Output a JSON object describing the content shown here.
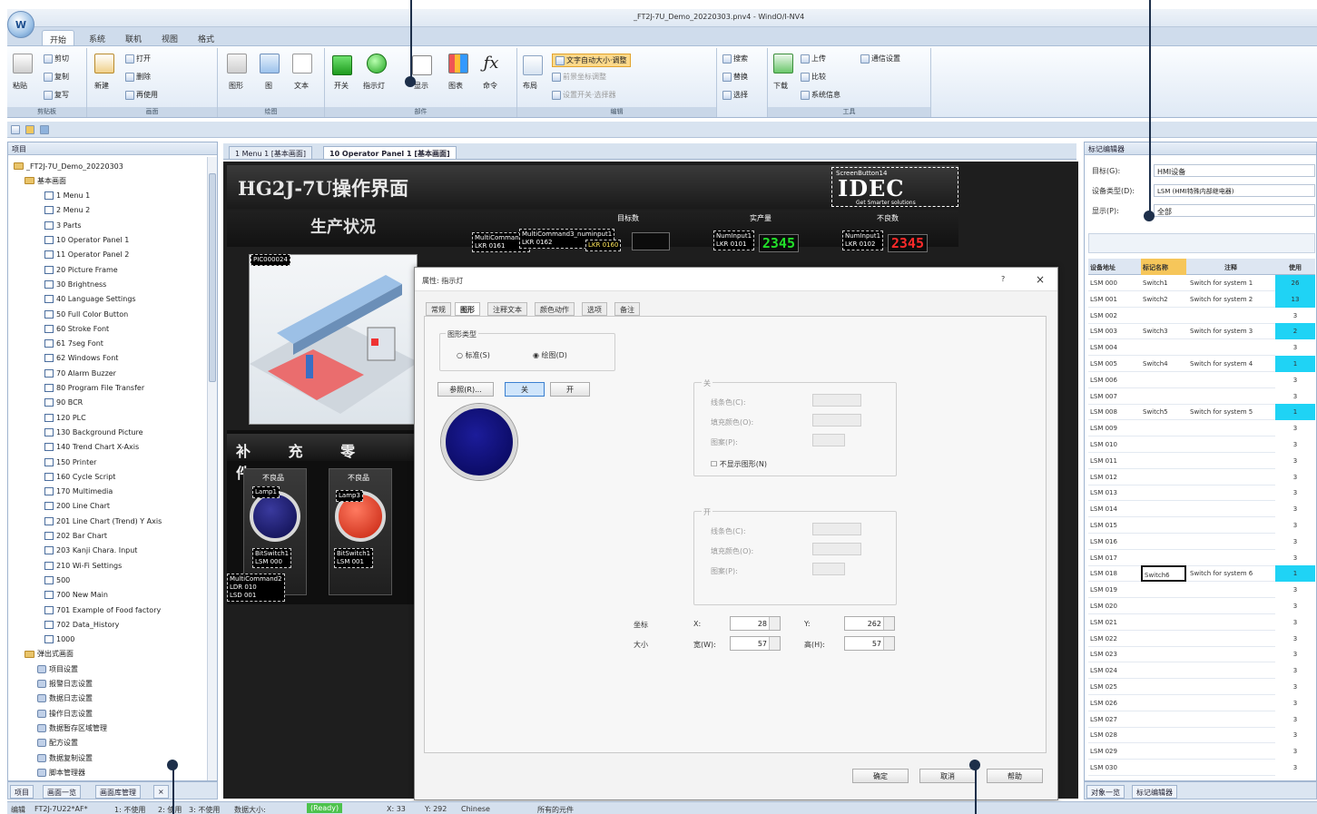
{
  "window": {
    "title": "_FT2J-7U_Demo_20220303.pnv4 - WindO/I-NV4",
    "app_logo": "W"
  },
  "ribbon": {
    "tabs": [
      "开始",
      "系统",
      "联机",
      "视图",
      "格式"
    ],
    "groups": [
      "剪贴板",
      "画面",
      "绘图",
      "部件",
      "编辑",
      "工具"
    ],
    "clipboard": {
      "paste": "粘贴",
      "cut": "剪切",
      "copy": "复制",
      "format_copy": "复写"
    },
    "screen": {
      "new": "新建",
      "open": "打开",
      "delete": "删除",
      "reuse": "再使用"
    },
    "drawing": {
      "shape": "图形",
      "image": "图",
      "text": "文本"
    },
    "parts": {
      "switch": "开关",
      "lamp": "指示灯",
      "display": "显示",
      "chart": "图表",
      "command": "命令"
    },
    "edit": {
      "layout": "布局",
      "auto_resize": "文字自动大小·调整",
      "f1": "前景坐标调整",
      "f2": "设置开关·选择器"
    },
    "find": {
      "search": "搜索",
      "replace": "替换",
      "select": "选择"
    },
    "tools": {
      "download": "下载",
      "upload": "上传",
      "compare": "比较",
      "sysinfo": "系统信息",
      "comm": "通信设置"
    }
  },
  "left_panel": {
    "title": "项目",
    "root": "_FT2J-7U_Demo_20220303",
    "base_folder": "基本画面",
    "screens": [
      "1 Menu 1",
      "2 Menu 2",
      "3 Parts",
      "10 Operator Panel 1",
      "11 Operator Panel 2",
      "20 Picture Frame",
      "30 Brightness",
      "40 Language Settings",
      "50 Full Color Button",
      "60 Stroke Font",
      "61 7seg Font",
      "62 Windows Font",
      "70 Alarm Buzzer",
      "80 Program File Transfer",
      "90 BCR",
      "120 PLC",
      "130 Background Picture",
      "140 Trend Chart X-Axis",
      "150 Printer",
      "160 Cycle Script",
      "170 Multimedia",
      "200 Line Chart",
      "201 Line Chart (Trend) Y Axis",
      "202 Bar Chart",
      "203 Kanji Chara. Input",
      "210 Wi-Fi Settings",
      "500",
      "700 New Main",
      "701 Example of Food factory",
      "702 Data_History",
      "1000"
    ],
    "other_items": [
      "弹出式画面",
      "项目设置",
      "报警日志设置",
      "数据日志设置",
      "操作日志设置",
      "数据暂存区域管理",
      "配方设置",
      "数据复制设置",
      "脚本管理器"
    ],
    "bottom_tabs": [
      "项目",
      "画面一览",
      "画面库管理",
      "×"
    ]
  },
  "doc_tabs": [
    "1 Menu 1 [基本画面]",
    "10 Operator Panel 1 [基本画面]"
  ],
  "hmi": {
    "title": "HG2J-7U操作界面",
    "idec_caption": "ScreenButton14",
    "idec_logo": "IDEC",
    "idec_sub": "Get Smarter solutions",
    "prod_title": "生产状况",
    "headers": [
      "目标数",
      "实产量",
      "不良数"
    ],
    "num1": {
      "name": "NumInput1",
      "addr": "LKR 0101",
      "value": "2345"
    },
    "num2": {
      "name": "NumInput1",
      "addr": "LKR 0102",
      "value": "2345"
    },
    "mc_tags": [
      "MultiCommand1",
      "LKR 0161",
      "MultiCommand3_numinput1",
      "LKR 0162",
      "LKR 0160"
    ],
    "factory_tag": "PIC000024",
    "lower_title": "补 充 零 件",
    "lamp1": {
      "caption": "不良品",
      "name": "Lamp1",
      "switch": "BitSwitch1",
      "addr": "LSM 000"
    },
    "lamp2": {
      "caption": "不良品",
      "name": "Lamp3",
      "switch": "BitSwitch1",
      "addr": "LSM 001"
    },
    "lower_tags": [
      "MultiCommand2",
      "LDR 010",
      "LSD 001"
    ]
  },
  "dialog": {
    "title": "属性: 指示灯",
    "help": "?",
    "close": "×",
    "tabs": [
      "常规",
      "图形",
      "注释文本",
      "颜色动作",
      "选项",
      "备注"
    ],
    "shape_type_label": "图形类型",
    "radio_std": "标准(S)",
    "radio_draw": "绘图(D)",
    "ref_button": "参照(R)...",
    "off_button": "关",
    "on_button": "开",
    "group_off": "关",
    "group_on": "开",
    "border_color": "线条色(C):",
    "fill_color": "填充颜色(O):",
    "pattern": "图案(P):",
    "no_display": "不显示图形(N)",
    "coord_label": "坐标",
    "size_label": "大小",
    "x_label": "X:",
    "y_label": "Y:",
    "w_label": "宽(W):",
    "h_label": "高(H):",
    "x_value": "28",
    "y_value": "262",
    "w_value": "57",
    "h_value": "57",
    "ok": "确定",
    "cancel": "取消",
    "help_btn": "帮助"
  },
  "right_panel": {
    "title": "标记编辑器",
    "target_label": "目标(G):",
    "target_value": "HMI设备",
    "type_label": "设备类型(D):",
    "type_value": "LSM (HMI特殊内部继电器)",
    "display_label": "显示(P):",
    "display_value": "全部",
    "columns": [
      "设备地址",
      "标记名称",
      "注释",
      "使用"
    ],
    "rows": [
      {
        "addr": "LSM 000",
        "tag": "Switch1",
        "comment": "Switch for system 1",
        "use": "26",
        "on": true
      },
      {
        "addr": "LSM 001",
        "tag": "Switch2",
        "comment": "Switch for system 2",
        "use": "13",
        "on": true
      },
      {
        "addr": "LSM 002",
        "tag": "",
        "comment": "",
        "use": "3",
        "on": false
      },
      {
        "addr": "LSM 003",
        "tag": "Switch3",
        "comment": "Switch for system 3",
        "use": "2",
        "on": true
      },
      {
        "addr": "LSM 004",
        "tag": "",
        "comment": "",
        "use": "3",
        "on": false
      },
      {
        "addr": "LSM 005",
        "tag": "Switch4",
        "comment": "Switch for system 4",
        "use": "1",
        "on": true
      },
      {
        "addr": "LSM 006",
        "tag": "",
        "comment": "",
        "use": "3",
        "on": false
      },
      {
        "addr": "LSM 007",
        "tag": "",
        "comment": "",
        "use": "3",
        "on": false
      },
      {
        "addr": "LSM 008",
        "tag": "Switch5",
        "comment": "Switch for system 5",
        "use": "1",
        "on": true
      },
      {
        "addr": "LSM 009",
        "tag": "",
        "comment": "",
        "use": "3",
        "on": false
      },
      {
        "addr": "LSM 010",
        "tag": "",
        "comment": "",
        "use": "3",
        "on": false
      },
      {
        "addr": "LSM 011",
        "tag": "",
        "comment": "",
        "use": "3",
        "on": false
      },
      {
        "addr": "LSM 012",
        "tag": "",
        "comment": "",
        "use": "3",
        "on": false
      },
      {
        "addr": "LSM 013",
        "tag": "",
        "comment": "",
        "use": "3",
        "on": false
      },
      {
        "addr": "LSM 014",
        "tag": "",
        "comment": "",
        "use": "3",
        "on": false
      },
      {
        "addr": "LSM 015",
        "tag": "",
        "comment": "",
        "use": "3",
        "on": false
      },
      {
        "addr": "LSM 016",
        "tag": "",
        "comment": "",
        "use": "3",
        "on": false
      },
      {
        "addr": "LSM 017",
        "tag": "",
        "comment": "",
        "use": "3",
        "on": false
      },
      {
        "addr": "LSM 018",
        "tag": "Switch6",
        "comment": "Switch for system 6",
        "use": "1",
        "on": true
      },
      {
        "addr": "LSM 019",
        "tag": "",
        "comment": "",
        "use": "3",
        "on": false
      },
      {
        "addr": "LSM 020",
        "tag": "",
        "comment": "",
        "use": "3",
        "on": false
      },
      {
        "addr": "LSM 021",
        "tag": "",
        "comment": "",
        "use": "3",
        "on": false
      },
      {
        "addr": "LSM 022",
        "tag": "",
        "comment": "",
        "use": "3",
        "on": false
      },
      {
        "addr": "LSM 023",
        "tag": "",
        "comment": "",
        "use": "3",
        "on": false
      },
      {
        "addr": "LSM 024",
        "tag": "",
        "comment": "",
        "use": "3",
        "on": false
      },
      {
        "addr": "LSM 025",
        "tag": "",
        "comment": "",
        "use": "3",
        "on": false
      },
      {
        "addr": "LSM 026",
        "tag": "",
        "comment": "",
        "use": "3",
        "on": false
      },
      {
        "addr": "LSM 027",
        "tag": "",
        "comment": "",
        "use": "3",
        "on": false
      },
      {
        "addr": "LSM 028",
        "tag": "",
        "comment": "",
        "use": "3",
        "on": false
      },
      {
        "addr": "LSM 029",
        "tag": "",
        "comment": "",
        "use": "3",
        "on": false
      },
      {
        "addr": "LSM 030",
        "tag": "",
        "comment": "",
        "use": "3",
        "on": false
      }
    ],
    "bottom_tabs": [
      "对象一览",
      "标记编辑器"
    ]
  },
  "status": {
    "items": [
      "编辑",
      "FT2J-7U22*AF*",
      "1: 不使用",
      "2: 使用",
      "3: 不使用",
      "数据大小:",
      "X: 33",
      "Y: 292",
      "Chinese",
      "所有的元件"
    ],
    "progress_label": "(Ready)"
  }
}
